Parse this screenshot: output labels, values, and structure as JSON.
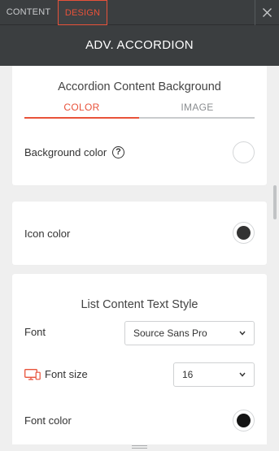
{
  "tabs": {
    "content_label": "CONTENT",
    "design_label": "DESIGN"
  },
  "header": {
    "title": "ADV. ACCORDION"
  },
  "accordion_bg": {
    "title": "Accordion Content Background",
    "subtabs": [
      "COLOR",
      "IMAGE"
    ],
    "active_subtab": "COLOR",
    "background_color_label": "Background color",
    "help_glyph": "?",
    "background_color_value": "#ffffff"
  },
  "icon": {
    "label": "Icon color",
    "color_value": "#333333"
  },
  "list_text_style": {
    "title": "List Content Text Style",
    "font_label": "Font",
    "font_value": "Source Sans Pro",
    "font_size_label": "Font size",
    "font_size_value": "16",
    "font_color_label": "Font color",
    "font_color_value": "#141414"
  },
  "colors": {
    "accent": "#e8523a",
    "header_bg": "#3b3e40",
    "panel_bg": "#ffffff",
    "page_bg": "#efefef"
  },
  "icons": {
    "close": "close-icon",
    "help": "help-icon",
    "dropdown": "chevron-down-icon",
    "device": "desktop-mobile-icon",
    "grip": "resize-grip-icon"
  }
}
